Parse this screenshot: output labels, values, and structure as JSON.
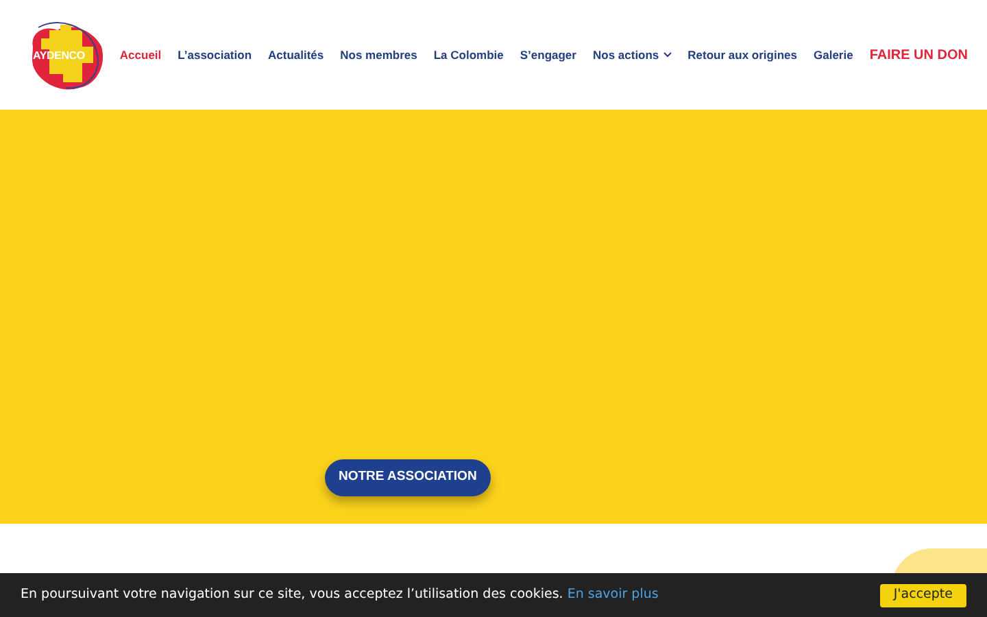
{
  "logo": {
    "text": "AYDENCO"
  },
  "nav": [
    {
      "label": "Accueil",
      "selected": true,
      "kind": "link",
      "has_submenu": false
    },
    {
      "label": "L’association",
      "selected": false,
      "kind": "link",
      "has_submenu": false
    },
    {
      "label": "Actualités",
      "selected": false,
      "kind": "link",
      "has_submenu": false
    },
    {
      "label": "Nos membres",
      "selected": false,
      "kind": "link",
      "has_submenu": false
    },
    {
      "label": "La Colombie",
      "selected": false,
      "kind": "link",
      "has_submenu": false
    },
    {
      "label": "S’engager",
      "selected": false,
      "kind": "link",
      "has_submenu": false
    },
    {
      "label": "Nos actions",
      "selected": false,
      "kind": "link",
      "has_submenu": true
    },
    {
      "label": "Retour aux origines",
      "selected": false,
      "kind": "link",
      "has_submenu": false
    },
    {
      "label": "Galerie",
      "selected": false,
      "kind": "link",
      "has_submenu": false
    },
    {
      "label": "FAIRE UN DON",
      "selected": false,
      "kind": "cta",
      "has_submenu": false
    }
  ],
  "hero": {
    "button": "NOTRE ASSOCIATION"
  },
  "cookie_bar": {
    "message": "En poursuivant votre navigation sur ce site, vous acceptez l’utilisation des cookies.",
    "link": "En savoir plus",
    "button": "J'accepte"
  }
}
